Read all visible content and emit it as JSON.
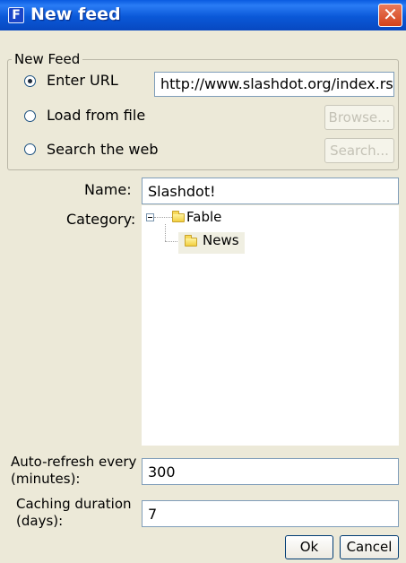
{
  "window": {
    "title": "New feed",
    "app_icon_letter": "F",
    "close_symbol": "✕"
  },
  "source_group": {
    "title": "New Feed",
    "options": [
      {
        "label": "Enter URL",
        "checked": true
      },
      {
        "label": "Load from file",
        "checked": false
      },
      {
        "label": "Search the web",
        "checked": false
      }
    ],
    "url_value": "http://www.slashdot.org/index.rss",
    "browse_label": "Browse...",
    "search_label": "Search..."
  },
  "name": {
    "label": "Name:",
    "value": "Slashdot!"
  },
  "category": {
    "label": "Category:",
    "tree": [
      {
        "label": "Fable",
        "expanded": true,
        "children": [
          {
            "label": "News",
            "selected": true
          }
        ]
      }
    ]
  },
  "auto_refresh": {
    "label_line1": "Auto-refresh every",
    "label_line2": "(minutes):",
    "value": "300"
  },
  "caching": {
    "label_line1": "Caching duration",
    "label_line2": "(days):",
    "value": "7"
  },
  "buttons": {
    "ok": "Ok",
    "cancel": "Cancel"
  }
}
